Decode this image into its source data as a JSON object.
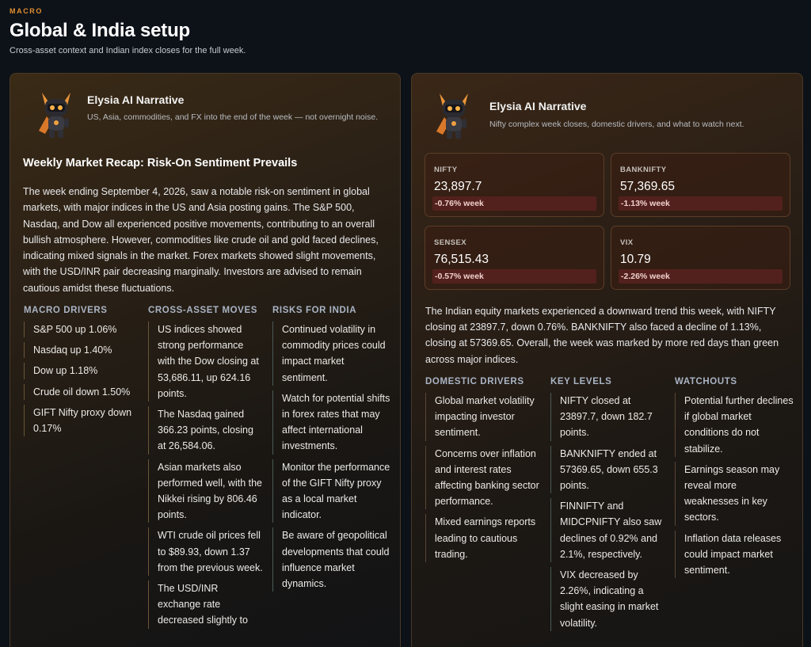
{
  "header": {
    "eyebrow": "MACRO",
    "title": "Global & India setup",
    "subtitle": "Cross-asset context and Indian index closes for the full week."
  },
  "global_card": {
    "narrative_title": "Elysia AI Narrative",
    "narrative_subtitle": "US, Asia, commodities, and FX into the end of the week — not overnight noise.",
    "recap_title": "Weekly Market Recap: Risk-On Sentiment Prevails",
    "recap_body": "The week ending September 4, 2026, saw a notable risk-on sentiment in global markets, with major indices in the US and Asia posting gains. The S&P 500, Nasdaq, and Dow all experienced positive movements, contributing to an overall bullish atmosphere. However, commodities like crude oil and gold faced declines, indicating mixed signals in the market. Forex markets showed slight movements, with the USD/INR pair decreasing marginally. Investors are advised to remain cautious amidst these fluctuations.",
    "columns": [
      {
        "heading": "MACRO DRIVERS",
        "items": [
          "S&P 500 up 1.06%",
          "Nasdaq up 1.40%",
          "Dow up 1.18%",
          "Crude oil down 1.50%",
          "GIFT Nifty proxy down 0.17%"
        ]
      },
      {
        "heading": "CROSS-ASSET MOVES",
        "items": [
          "US indices showed strong performance with the Dow closing at 53,686.11, up 624.16 points.",
          "The Nasdaq gained 366.23 points, closing at 26,584.06.",
          "Asian markets also performed well, with the Nikkei rising by 806.46 points.",
          "WTI crude oil prices fell to $89.93, down 1.37 from the previous week.",
          "The USD/INR exchange rate decreased slightly to"
        ]
      },
      {
        "heading": "RISKS FOR INDIA",
        "items": [
          "Continued volatility in commodity prices could impact market sentiment.",
          "Watch for potential shifts in forex rates that may affect international investments.",
          "Monitor the performance of the GIFT Nifty proxy as a local market indicator.",
          "Be aware of geopolitical developments that could influence market dynamics."
        ]
      }
    ]
  },
  "india_card": {
    "narrative_title": "Elysia AI Narrative",
    "narrative_subtitle": "Nifty complex week closes, domestic drivers, and what to watch next.",
    "metrics": [
      {
        "label": "NIFTY",
        "value": "23,897.7",
        "change": "-0.76% week"
      },
      {
        "label": "BANKNIFTY",
        "value": "57,369.65",
        "change": "-1.13% week"
      },
      {
        "label": "SENSEX",
        "value": "76,515.43",
        "change": "-0.57% week"
      },
      {
        "label": "VIX",
        "value": "10.79",
        "change": "-2.26% week"
      }
    ],
    "body": "The Indian equity markets experienced a downward trend this week, with NIFTY closing at 23897.7, down 0.76%. BANKNIFTY also faced a decline of 1.13%, closing at 57369.65. Overall, the week was marked by more red days than green across major indices.",
    "columns": [
      {
        "heading": "DOMESTIC DRIVERS",
        "items": [
          "Global market volatility impacting investor sentiment.",
          "Concerns over inflation and interest rates affecting banking sector performance.",
          "Mixed earnings reports leading to cautious trading."
        ]
      },
      {
        "heading": "KEY LEVELS",
        "items": [
          "NIFTY closed at 23897.7, down 182.7 points.",
          "BANKNIFTY ended at 57369.65, down 655.3 points.",
          "FINNIFTY and MIDCPNIFTY also saw declines of 0.92% and 2.1%, respectively.",
          "VIX decreased by 2.26%, indicating a slight easing in market volatility."
        ]
      },
      {
        "heading": "WATCHOUTS",
        "items": [
          "Potential further declines if global market conditions do not stabilize.",
          "Earnings season may reveal more weaknesses in key sectors.",
          "Inflation data releases could impact market sentiment."
        ]
      }
    ]
  },
  "colors": {
    "background": "#0d1118",
    "accent_orange": "#e0902e",
    "negative_badge": "#53211d"
  },
  "icons": {
    "avatar": "robot-mascot-avatar"
  }
}
